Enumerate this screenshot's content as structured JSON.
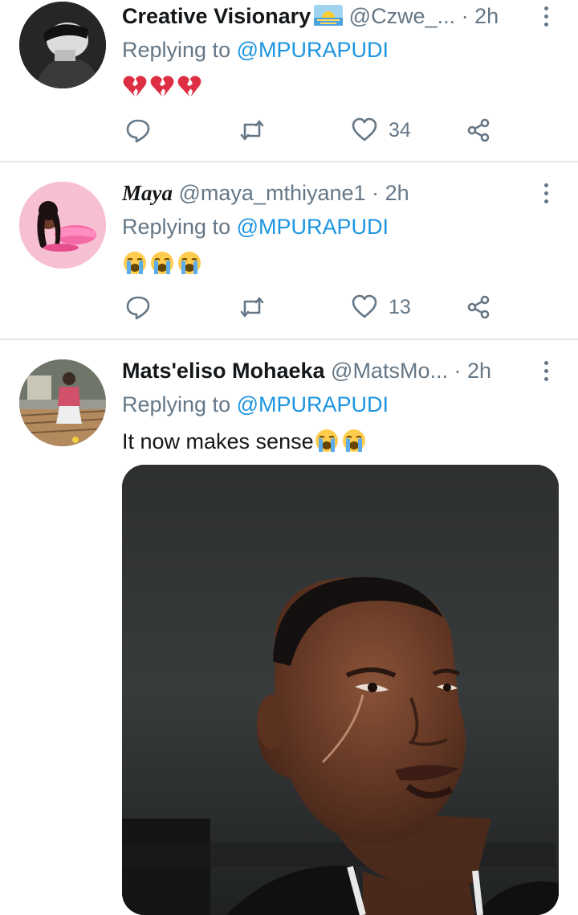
{
  "tweets": [
    {
      "name": "Creative Visionary",
      "handle": "@Czwe_...",
      "time": "2h",
      "reply_prefix": "Replying to ",
      "reply_to": "@MPURAPUDI",
      "text": "",
      "emoji": [
        "broken-heart",
        "broken-heart",
        "broken-heart"
      ],
      "retweets": "",
      "likes": "34"
    },
    {
      "name": "Maya",
      "handle": "@maya_mthiyane1",
      "time": "2h",
      "reply_prefix": "Replying to ",
      "reply_to": "@MPURAPUDI",
      "text": "",
      "emoji": [
        "crying-face",
        "crying-face",
        "crying-face"
      ],
      "retweets": "",
      "likes": "13"
    },
    {
      "name": "Mats'eliso Mohaeka",
      "handle": "@MatsMo...",
      "time": "2h",
      "reply_prefix": "Replying to ",
      "reply_to": "@MPURAPUDI",
      "text": "It now makes sense",
      "emoji": [
        "crying-face",
        "crying-face"
      ]
    }
  ],
  "separator": "·",
  "colors": {
    "accent": "#1b95e0",
    "secondary_text": "#657786",
    "divider": "#e1e8ed"
  }
}
